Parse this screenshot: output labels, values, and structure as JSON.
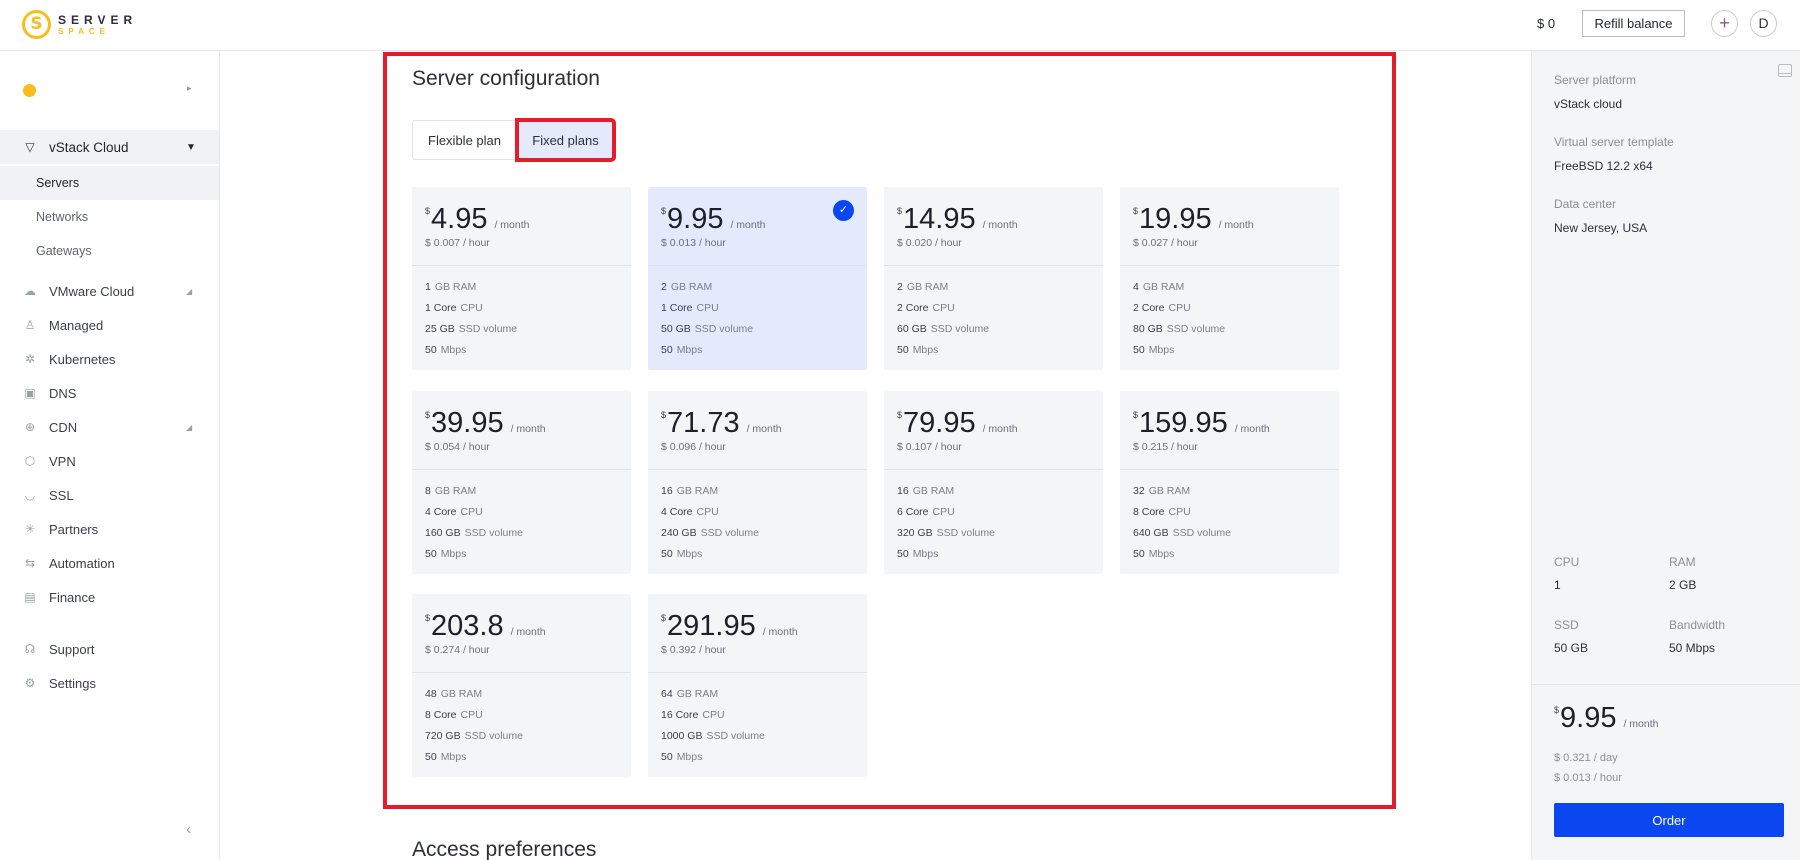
{
  "header": {
    "logo_top": "SERVER",
    "logo_bottom": "SPACE",
    "balance": "$ 0",
    "refill_label": "Refill balance",
    "add_label": "+",
    "avatar_initial": "D"
  },
  "sidebar": {
    "account_arrow": "▸",
    "group": {
      "label": "vStack Cloud",
      "icon": "vstack-icon"
    },
    "sub_items": [
      {
        "label": "Servers",
        "active": true
      },
      {
        "label": "Networks",
        "active": false
      },
      {
        "label": "Gateways",
        "active": false
      }
    ],
    "items": [
      {
        "label": "VMware Cloud",
        "icon": "cloud-icon",
        "glyph": "☁",
        "has_caret": true
      },
      {
        "label": "Managed",
        "icon": "managed-icon",
        "glyph": "♙",
        "has_caret": false
      },
      {
        "label": "Kubernetes",
        "icon": "kubernetes-icon",
        "glyph": "✲",
        "has_caret": false
      },
      {
        "label": "DNS",
        "icon": "dns-icon",
        "glyph": "▣",
        "has_caret": false
      },
      {
        "label": "CDN",
        "icon": "globe-icon",
        "glyph": "⊕",
        "has_caret": true
      },
      {
        "label": "VPN",
        "icon": "vpn-icon",
        "glyph": "⬡",
        "has_caret": false
      },
      {
        "label": "SSL",
        "icon": "shield-icon",
        "glyph": "◡",
        "has_caret": false
      },
      {
        "label": "Partners",
        "icon": "partners-icon",
        "glyph": "✳",
        "has_caret": false
      },
      {
        "label": "Automation",
        "icon": "automation-icon",
        "glyph": "⇆",
        "has_caret": false
      },
      {
        "label": "Finance",
        "icon": "document-icon",
        "glyph": "▤",
        "has_caret": false
      }
    ],
    "bottom_items": [
      {
        "label": "Support",
        "icon": "headset-icon",
        "glyph": "☊"
      },
      {
        "label": "Settings",
        "icon": "gear-icon",
        "glyph": "⚙"
      }
    ],
    "collapse_glyph": "‹"
  },
  "main": {
    "title": "Server configuration",
    "tabs": [
      {
        "label": "Flexible plan",
        "active": false
      },
      {
        "label": "Fixed plans",
        "active": true
      }
    ],
    "currency": "$",
    "per_month": "/ month",
    "plans": [
      {
        "price": "4.95",
        "hourly": "$ 0.007 / hour",
        "selected": false,
        "specs": [
          [
            "1",
            "GB RAM"
          ],
          [
            "1 Core",
            "CPU"
          ],
          [
            "25 GB",
            "SSD volume"
          ],
          [
            "50",
            "Mbps"
          ]
        ]
      },
      {
        "price": "9.95",
        "hourly": "$ 0.013 / hour",
        "selected": true,
        "specs": [
          [
            "2",
            "GB RAM"
          ],
          [
            "1 Core",
            "CPU"
          ],
          [
            "50 GB",
            "SSD volume"
          ],
          [
            "50",
            "Mbps"
          ]
        ]
      },
      {
        "price": "14.95",
        "hourly": "$ 0.020 / hour",
        "selected": false,
        "specs": [
          [
            "2",
            "GB RAM"
          ],
          [
            "2 Core",
            "CPU"
          ],
          [
            "60 GB",
            "SSD volume"
          ],
          [
            "50",
            "Mbps"
          ]
        ]
      },
      {
        "price": "19.95",
        "hourly": "$ 0.027 / hour",
        "selected": false,
        "specs": [
          [
            "4",
            "GB RAM"
          ],
          [
            "2 Core",
            "CPU"
          ],
          [
            "80 GB",
            "SSD volume"
          ],
          [
            "50",
            "Mbps"
          ]
        ]
      },
      {
        "price": "39.95",
        "hourly": "$ 0.054 / hour",
        "selected": false,
        "specs": [
          [
            "8",
            "GB RAM"
          ],
          [
            "4 Core",
            "CPU"
          ],
          [
            "160 GB",
            "SSD volume"
          ],
          [
            "50",
            "Mbps"
          ]
        ]
      },
      {
        "price": "71.73",
        "hourly": "$ 0.096 / hour",
        "selected": false,
        "specs": [
          [
            "16",
            "GB RAM"
          ],
          [
            "4 Core",
            "CPU"
          ],
          [
            "240 GB",
            "SSD volume"
          ],
          [
            "50",
            "Mbps"
          ]
        ]
      },
      {
        "price": "79.95",
        "hourly": "$ 0.107 / hour",
        "selected": false,
        "specs": [
          [
            "16",
            "GB RAM"
          ],
          [
            "6 Core",
            "CPU"
          ],
          [
            "320 GB",
            "SSD volume"
          ],
          [
            "50",
            "Mbps"
          ]
        ]
      },
      {
        "price": "159.95",
        "hourly": "$ 0.215 / hour",
        "selected": false,
        "specs": [
          [
            "32",
            "GB RAM"
          ],
          [
            "8 Core",
            "CPU"
          ],
          [
            "640 GB",
            "SSD volume"
          ],
          [
            "50",
            "Mbps"
          ]
        ]
      },
      {
        "price": "203.8",
        "hourly": "$ 0.274 / hour",
        "selected": false,
        "specs": [
          [
            "48",
            "GB RAM"
          ],
          [
            "8 Core",
            "CPU"
          ],
          [
            "720 GB",
            "SSD volume"
          ],
          [
            "50",
            "Mbps"
          ]
        ]
      },
      {
        "price": "291.95",
        "hourly": "$ 0.392 / hour",
        "selected": false,
        "specs": [
          [
            "64",
            "GB RAM"
          ],
          [
            "16 Core",
            "CPU"
          ],
          [
            "1000 GB",
            "SSD volume"
          ],
          [
            "50",
            "Mbps"
          ]
        ]
      }
    ],
    "check_glyph": "✓",
    "access_title": "Access preferences"
  },
  "summary": {
    "platform_label": "Server platform",
    "platform_value": "vStack cloud",
    "template_label": "Virtual server template",
    "template_value": "FreeBSD 12.2 x64",
    "datacenter_label": "Data center",
    "datacenter_value": "New Jersey, USA",
    "stats": [
      {
        "label": "CPU",
        "value": "1"
      },
      {
        "label": "RAM",
        "value": "2 GB"
      },
      {
        "label": "SSD",
        "value": "50 GB"
      },
      {
        "label": "Bandwidth",
        "value": "50 Mbps"
      }
    ],
    "currency": "$",
    "price": "9.95",
    "per_month": "/ month",
    "per_day": "$ 0.321 / day",
    "per_hour": "$ 0.013 / hour",
    "order_label": "Order"
  },
  "colors": {
    "brand_yellow": "#f6bf1c",
    "accent_blue": "#0a47f0",
    "selected_card_bg": "#e4e9fb",
    "highlight_red": "#e31e2a"
  }
}
